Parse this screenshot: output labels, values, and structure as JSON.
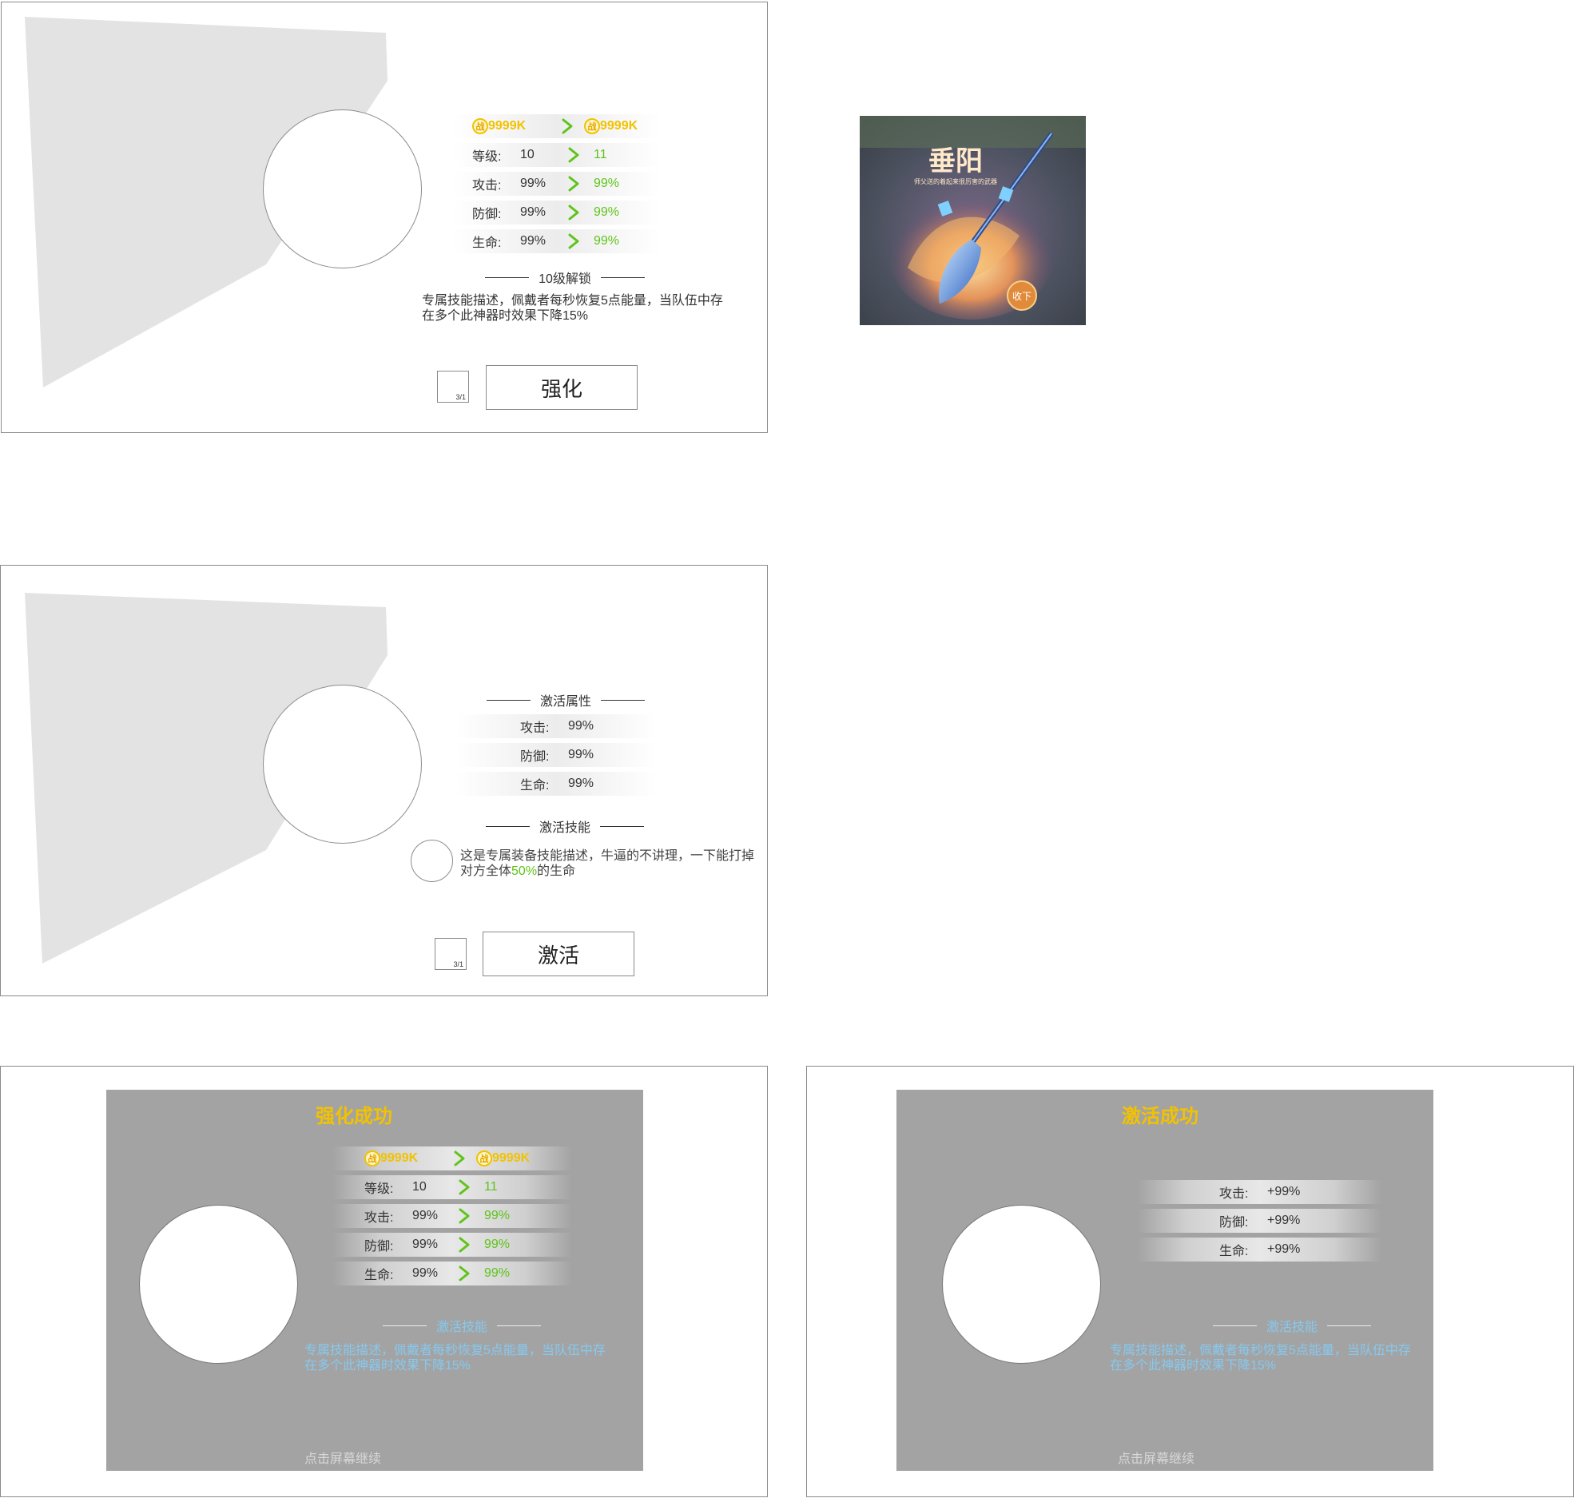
{
  "panel_enhance": {
    "power_from": "9999K",
    "power_to": "9999K",
    "coin_glyph": "战",
    "stats": [
      {
        "label": "等级:",
        "from": "10",
        "to": "11"
      },
      {
        "label": "攻击:",
        "from": "99%",
        "to": "99%"
      },
      {
        "label": "防御:",
        "from": "99%",
        "to": "99%"
      },
      {
        "label": "生命:",
        "from": "99%",
        "to": "99%"
      }
    ],
    "unlock_title": "10级解锁",
    "skill_desc": "专属技能描述，佩戴者每秒恢复5点能量，当队伍中存在多个此神器时效果下降15%",
    "counter": "3/1",
    "button": "强化"
  },
  "thumbnail": {
    "title": "垂阳",
    "subtitle": "师父送的着起来很厉害的武器",
    "collect_button": "收下"
  },
  "panel_activate": {
    "attr_title": "激活属性",
    "stats": [
      {
        "label": "攻击:",
        "value": "99%"
      },
      {
        "label": "防御:",
        "value": "99%"
      },
      {
        "label": "生命:",
        "value": "99%"
      }
    ],
    "skill_title": "激活技能",
    "skill_desc_a": "这是专属装备技能描述，牛逼的不讲理，一下能打掉对方全体",
    "skill_desc_pct": "50%",
    "skill_desc_b": "的生命",
    "counter": "3/1",
    "button": "激活"
  },
  "popup_enhance": {
    "title": "强化成功",
    "power_from": "9999K",
    "power_to": "9999K",
    "coin_glyph": "战",
    "stats": [
      {
        "label": "等级:",
        "from": "10",
        "to": "11"
      },
      {
        "label": "攻击:",
        "from": "99%",
        "to": "99%"
      },
      {
        "label": "防御:",
        "from": "99%",
        "to": "99%"
      },
      {
        "label": "生命:",
        "from": "99%",
        "to": "99%"
      }
    ],
    "skill_title": "激活技能",
    "skill_desc": "专属技能描述，佩戴者每秒恢复5点能量，当队伍中存在多个此神器时效果下降15%",
    "continue_hint": "点击屏幕继续"
  },
  "popup_activate": {
    "title": "激活成功",
    "stats": [
      {
        "label": "攻击:",
        "value": "+99%"
      },
      {
        "label": "防御:",
        "value": "+99%"
      },
      {
        "label": "生命:",
        "value": "+99%"
      }
    ],
    "skill_title": "激活技能",
    "skill_desc": "专属技能描述，佩戴者每秒恢复5点能量，当队伍中存在多个此神器时效果下降15%",
    "continue_hint": "点击屏幕继续"
  },
  "colors": {
    "gold": "#f2c200",
    "green": "#5ec41a",
    "blue_text": "#86c9f0",
    "overlay_gray": "#a3a3a3"
  }
}
